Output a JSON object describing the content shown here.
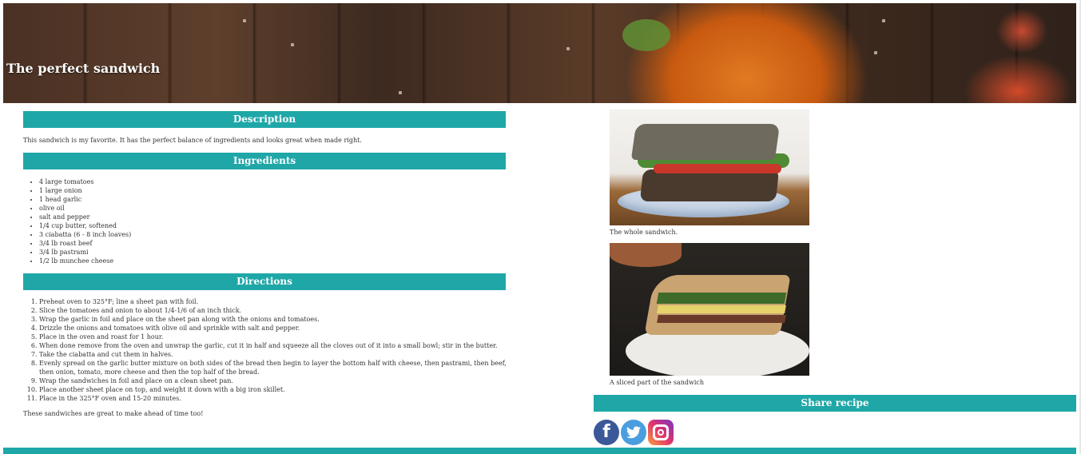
{
  "header": {
    "title": "The perfect sandwich"
  },
  "description": {
    "heading": "Description",
    "text": "This sandwich is my favorite. It has the perfect balance of ingredients and looks great when made right."
  },
  "ingredients": {
    "heading": "Ingredients",
    "items": [
      "4 large tomatoes",
      "1 large onion",
      "1 head garlic",
      "olive oil",
      "salt and pepper",
      "1/4 cup butter, softened",
      "3 ciabatta (6 - 8 inch loaves)",
      "3/4 lb roast beef",
      "3/4 lb pastrami",
      "1/2 lb munchee cheese"
    ]
  },
  "directions": {
    "heading": "Directions",
    "steps": [
      "Preheat oven to 325°F; line a sheet pan with foil.",
      "Slice the tomatoes and onion to about 1/4-1/6 of an inch thick.",
      "Wrap the garlic in foil and place on the sheet pan along with the onions and tomatoes.",
      "Drizzle the onions and tomatoes with olive oil and sprinkle with salt and pepper.",
      "Place in the oven and roast for 1 hour.",
      "When done remove from the oven and unwrap the garlic, cut it in half and squeeze all the cloves out of it into a small bowl; stir in the butter.",
      "Take the ciabatta and cut them in halves.",
      "Evenly spread on the garlic butter mixture on both sides of the bread then begin to layer the bottom half with cheese, then pastrami, then beef, then onion, tomato, more cheese and then the top half of the bread.",
      "Wrap the sandwiches in foil and place on a clean sheet pan.",
      "Place another sheet place on top, and weight it down with a big iron skillet.",
      "Place in the 325°F oven and 15-20 minutes."
    ],
    "closing": "These sandwiches are great to make ahead of time too!"
  },
  "gallery": {
    "caption1": "The whole sandwich.",
    "caption2": "A sliced part of the sandwich"
  },
  "share": {
    "heading": "Share recipe",
    "icons": [
      "facebook-icon",
      "twitter-icon",
      "instagram-icon"
    ]
  },
  "colors": {
    "accent": "#1fa7a8"
  }
}
